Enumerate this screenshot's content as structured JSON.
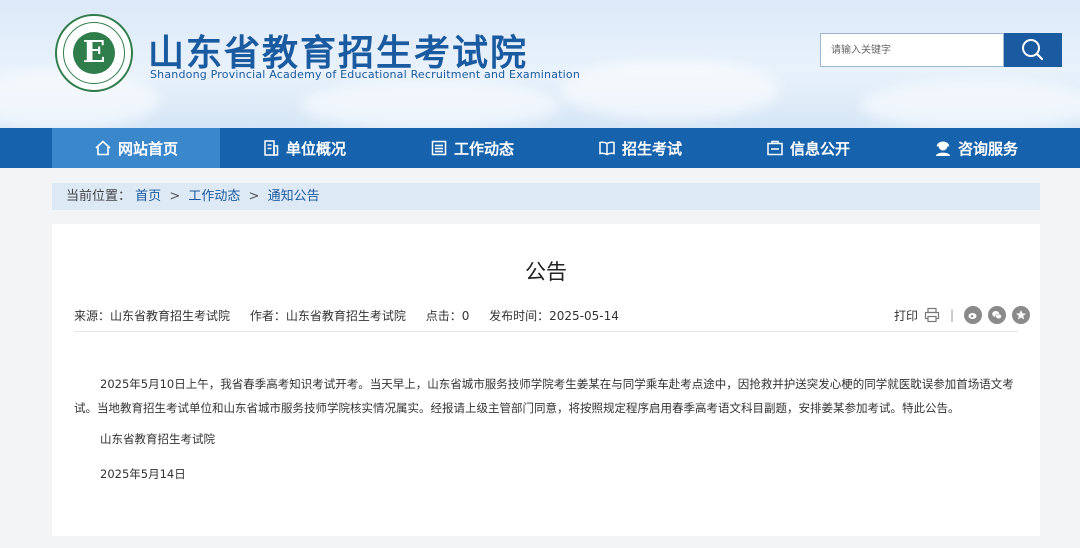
{
  "header": {
    "title": "山东省教育招生考试院",
    "subtitle": "Shandong Provincial Academy of Educational Recruitment and Examination",
    "logo_letter": "E"
  },
  "search": {
    "placeholder": "请输入关键字"
  },
  "nav": {
    "items": [
      {
        "label": "网站首页",
        "icon": "home-icon"
      },
      {
        "label": "单位概况",
        "icon": "building-icon"
      },
      {
        "label": "工作动态",
        "icon": "news-icon"
      },
      {
        "label": "招生考试",
        "icon": "book-icon"
      },
      {
        "label": "信息公开",
        "icon": "info-icon"
      },
      {
        "label": "咨询服务",
        "icon": "support-icon"
      }
    ]
  },
  "breadcrumb": {
    "prefix": "当前位置：",
    "items": [
      "首页",
      "工作动态",
      "通知公告"
    ],
    "separator": ">"
  },
  "article": {
    "title": "公告",
    "meta": {
      "source": "来源：山东省教育招生考试院",
      "author": "作者：山东省教育招生考试院",
      "clicks": "点击：0",
      "published": "发布时间：2025-05-14"
    },
    "print_label": "打印",
    "paragraph": "2025年5月10日上午，我省春季高考知识考试开考。当天早上，山东省城市服务技师学院考生姜某在与同学乘车赴考点途中，因抢救并护送突发心梗的同学就医耽误参加首场语文考试。当地教育招生考试单位和山东省城市服务技师学院核实情况属实。经报请上级主管部门同意，将按照规定程序启用春季高考语文科目副题，安排姜某参加考试。特此公告。",
    "signature": "山东省教育招生考试院",
    "date": "2025年5月14日"
  },
  "colors": {
    "brand": "#1a5aa0",
    "nav": "#1662ac",
    "nav_active": "#3a87cc"
  }
}
